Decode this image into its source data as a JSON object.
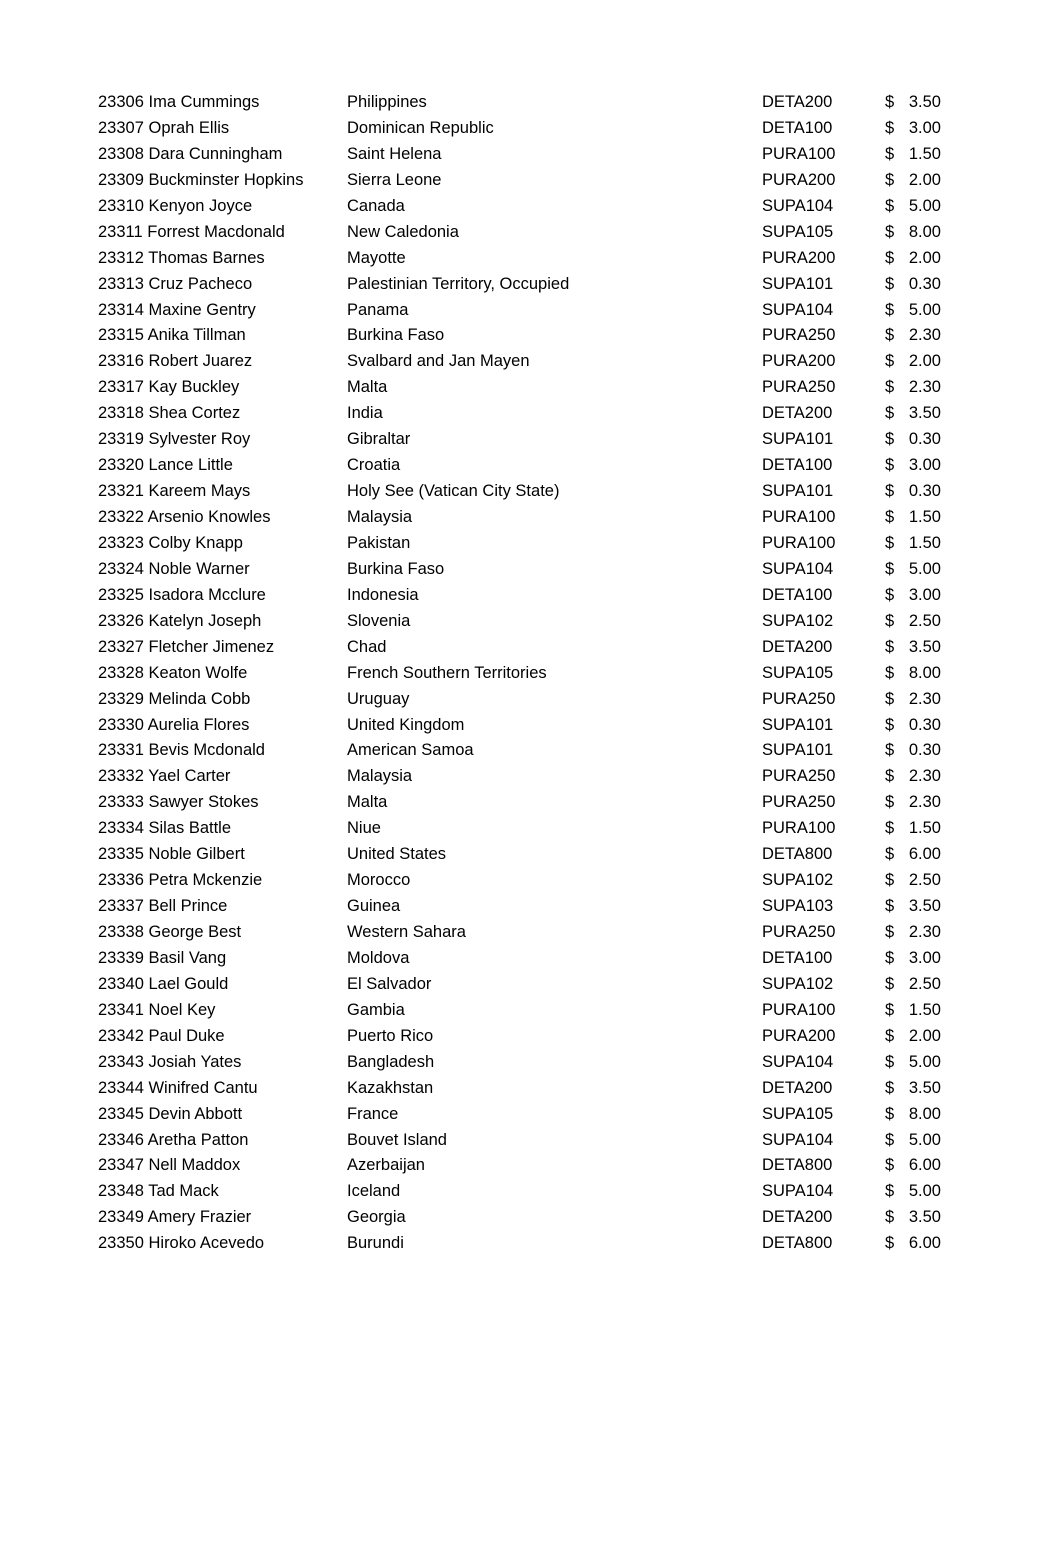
{
  "sheet": {
    "currency_symbol": "$",
    "rows": [
      {
        "id": "23306",
        "name": "Ima Cummings",
        "country": "Philippines",
        "code": "DETA200",
        "price": "3.50"
      },
      {
        "id": "23307",
        "name": "Oprah Ellis",
        "country": "Dominican Republic",
        "code": "DETA100",
        "price": "3.00"
      },
      {
        "id": "23308",
        "name": "Dara Cunningham",
        "country": "Saint Helena",
        "code": "PURA100",
        "price": "1.50"
      },
      {
        "id": "23309",
        "name": "Buckminster Hopkins",
        "country": "Sierra Leone",
        "code": "PURA200",
        "price": "2.00"
      },
      {
        "id": "23310",
        "name": "Kenyon Joyce",
        "country": "Canada",
        "code": "SUPA104",
        "price": "5.00"
      },
      {
        "id": "23311",
        "name": "Forrest Macdonald",
        "country": "New Caledonia",
        "code": "SUPA105",
        "price": "8.00"
      },
      {
        "id": "23312",
        "name": "Thomas Barnes",
        "country": "Mayotte",
        "code": "PURA200",
        "price": "2.00"
      },
      {
        "id": "23313",
        "name": "Cruz Pacheco",
        "country": "Palestinian Territory, Occupied",
        "code": "SUPA101",
        "price": "0.30"
      },
      {
        "id": "23314",
        "name": "Maxine Gentry",
        "country": "Panama",
        "code": "SUPA104",
        "price": "5.00"
      },
      {
        "id": "23315",
        "name": "Anika Tillman",
        "country": "Burkina Faso",
        "code": "PURA250",
        "price": "2.30"
      },
      {
        "id": "23316",
        "name": "Robert Juarez",
        "country": "Svalbard and Jan Mayen",
        "code": "PURA200",
        "price": "2.00"
      },
      {
        "id": "23317",
        "name": "Kay Buckley",
        "country": "Malta",
        "code": "PURA250",
        "price": "2.30"
      },
      {
        "id": "23318",
        "name": "Shea Cortez",
        "country": "India",
        "code": "DETA200",
        "price": "3.50"
      },
      {
        "id": "23319",
        "name": "Sylvester Roy",
        "country": "Gibraltar",
        "code": "SUPA101",
        "price": "0.30"
      },
      {
        "id": "23320",
        "name": "Lance Little",
        "country": "Croatia",
        "code": "DETA100",
        "price": "3.00"
      },
      {
        "id": "23321",
        "name": "Kareem Mays",
        "country": "Holy See (Vatican City State)",
        "code": "SUPA101",
        "price": "0.30"
      },
      {
        "id": "23322",
        "name": "Arsenio Knowles",
        "country": "Malaysia",
        "code": "PURA100",
        "price": "1.50"
      },
      {
        "id": "23323",
        "name": "Colby Knapp",
        "country": "Pakistan",
        "code": "PURA100",
        "price": "1.50"
      },
      {
        "id": "23324",
        "name": "Noble Warner",
        "country": "Burkina Faso",
        "code": "SUPA104",
        "price": "5.00"
      },
      {
        "id": "23325",
        "name": "Isadora Mcclure",
        "country": "Indonesia",
        "code": "DETA100",
        "price": "3.00"
      },
      {
        "id": "23326",
        "name": "Katelyn Joseph",
        "country": "Slovenia",
        "code": "SUPA102",
        "price": "2.50"
      },
      {
        "id": "23327",
        "name": "Fletcher Jimenez",
        "country": "Chad",
        "code": "DETA200",
        "price": "3.50"
      },
      {
        "id": "23328",
        "name": "Keaton Wolfe",
        "country": "French Southern Territories",
        "code": "SUPA105",
        "price": "8.00"
      },
      {
        "id": "23329",
        "name": "Melinda Cobb",
        "country": "Uruguay",
        "code": "PURA250",
        "price": "2.30"
      },
      {
        "id": "23330",
        "name": "Aurelia Flores",
        "country": "United Kingdom",
        "code": "SUPA101",
        "price": "0.30"
      },
      {
        "id": "23331",
        "name": "Bevis Mcdonald",
        "country": "American Samoa",
        "code": "SUPA101",
        "price": "0.30"
      },
      {
        "id": "23332",
        "name": "Yael Carter",
        "country": "Malaysia",
        "code": "PURA250",
        "price": "2.30"
      },
      {
        "id": "23333",
        "name": "Sawyer Stokes",
        "country": "Malta",
        "code": "PURA250",
        "price": "2.30"
      },
      {
        "id": "23334",
        "name": "Silas Battle",
        "country": "Niue",
        "code": "PURA100",
        "price": "1.50"
      },
      {
        "id": "23335",
        "name": "Noble Gilbert",
        "country": "United States",
        "code": "DETA800",
        "price": "6.00"
      },
      {
        "id": "23336",
        "name": "Petra Mckenzie",
        "country": "Morocco",
        "code": "SUPA102",
        "price": "2.50"
      },
      {
        "id": "23337",
        "name": "Bell Prince",
        "country": "Guinea",
        "code": "SUPA103",
        "price": "3.50"
      },
      {
        "id": "23338",
        "name": "George Best",
        "country": "Western Sahara",
        "code": "PURA250",
        "price": "2.30"
      },
      {
        "id": "23339",
        "name": "Basil Vang",
        "country": "Moldova",
        "code": "DETA100",
        "price": "3.00"
      },
      {
        "id": "23340",
        "name": "Lael Gould",
        "country": "El Salvador",
        "code": "SUPA102",
        "price": "2.50"
      },
      {
        "id": "23341",
        "name": "Noel Key",
        "country": "Gambia",
        "code": "PURA100",
        "price": "1.50"
      },
      {
        "id": "23342",
        "name": "Paul Duke",
        "country": "Puerto Rico",
        "code": "PURA200",
        "price": "2.00"
      },
      {
        "id": "23343",
        "name": "Josiah Yates",
        "country": "Bangladesh",
        "code": "SUPA104",
        "price": "5.00"
      },
      {
        "id": "23344",
        "name": "Winifred Cantu",
        "country": "Kazakhstan",
        "code": "DETA200",
        "price": "3.50"
      },
      {
        "id": "23345",
        "name": "Devin Abbott",
        "country": "France",
        "code": "SUPA105",
        "price": "8.00"
      },
      {
        "id": "23346",
        "name": "Aretha Patton",
        "country": "Bouvet Island",
        "code": "SUPA104",
        "price": "5.00"
      },
      {
        "id": "23347",
        "name": "Nell Maddox",
        "country": "Azerbaijan",
        "code": "DETA800",
        "price": "6.00"
      },
      {
        "id": "23348",
        "name": "Tad Mack",
        "country": "Iceland",
        "code": "SUPA104",
        "price": "5.00"
      },
      {
        "id": "23349",
        "name": "Amery Frazier",
        "country": "Georgia",
        "code": "DETA200",
        "price": "3.50"
      },
      {
        "id": "23350",
        "name": "Hiroko Acevedo",
        "country": "Burundi",
        "code": "DETA800",
        "price": "6.00"
      }
    ]
  }
}
